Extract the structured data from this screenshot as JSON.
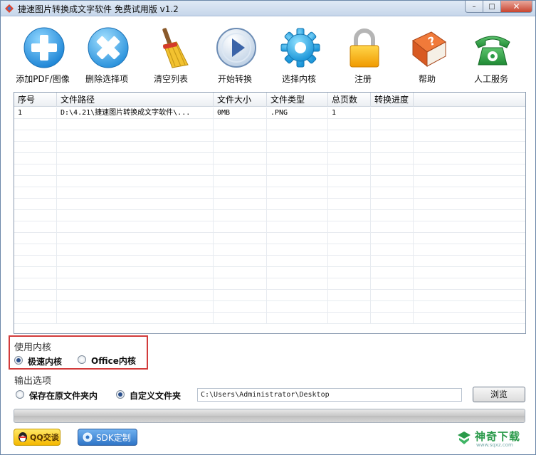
{
  "window": {
    "title": "捷速图片转换成文字软件 免费试用版 v1.2"
  },
  "toolbar": {
    "items": [
      {
        "label": "添加PDF/图像",
        "icon": "plus-circle-icon"
      },
      {
        "label": "删除选择项",
        "icon": "x-circle-icon"
      },
      {
        "label": "清空列表",
        "icon": "broom-icon"
      },
      {
        "label": "开始转换",
        "icon": "play-icon"
      },
      {
        "label": "选择内核",
        "icon": "gear-icon"
      },
      {
        "label": "注册",
        "icon": "lock-icon"
      },
      {
        "label": "帮助",
        "icon": "help-book-icon"
      },
      {
        "label": "人工服务",
        "icon": "phone-icon"
      }
    ]
  },
  "table": {
    "headers": [
      "序号",
      "文件路径",
      "文件大小",
      "文件类型",
      "总页数",
      "转换进度"
    ],
    "rows": [
      [
        "1",
        "D:\\4.21\\捷速图片转换成文字软件\\...",
        "0MB",
        ".PNG",
        "1",
        ""
      ]
    ]
  },
  "kernel": {
    "title": "使用内核",
    "options": [
      {
        "label": "极速内核",
        "selected": true
      },
      {
        "label": "Office内核",
        "selected": false
      }
    ]
  },
  "output": {
    "title": "输出选项",
    "options": [
      {
        "label": "保存在原文件夹内",
        "selected": false
      },
      {
        "label": "自定义文件夹",
        "selected": true
      }
    ],
    "path": "C:\\Users\\Administrator\\Desktop",
    "browse_label": "浏览"
  },
  "progress": {
    "value": 0
  },
  "footer": {
    "qq_label": "QQ交谈",
    "sdk_label": "SDK定制"
  },
  "watermark": {
    "text": "神奇下载",
    "sub": "www.sqxz.com"
  },
  "colors": {
    "kernel_highlight": "#d23b3b",
    "accent_blue": "#2f75c7"
  }
}
